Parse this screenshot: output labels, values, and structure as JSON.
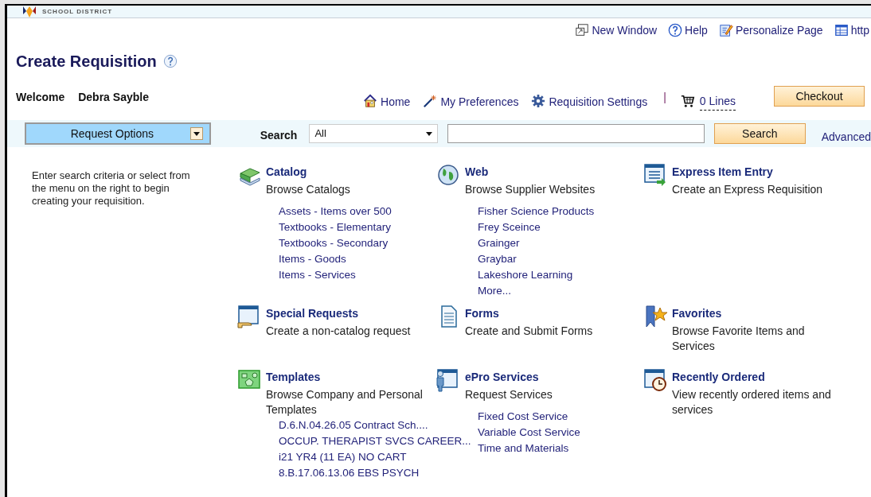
{
  "logo": {
    "text": "SCHOOL DISTRICT"
  },
  "top_links": [
    "New Window",
    "Help",
    "Personalize Page",
    "http"
  ],
  "title": "Create Requisition",
  "welcome": {
    "label": "Welcome",
    "name": "Debra Sayble"
  },
  "nav": {
    "links": [
      "Home",
      "My Preferences",
      "Requisition Settings"
    ],
    "separator": "|",
    "cart": "0 Lines",
    "checkout": "Checkout"
  },
  "search_bar": {
    "options_button": "Request Options",
    "label": "Search",
    "category": "All",
    "button": "Search",
    "advanced": "Advanced"
  },
  "instructions": "Enter search criteria or select from the menu on the right to begin creating your requisition.",
  "tiles": [
    {
      "title": "Catalog",
      "subtitle": "Browse Catalogs",
      "links": [
        "Assets - Items over 500",
        "Textbooks - Elementary",
        "Textbooks - Secondary",
        "Items - Goods",
        "Items - Services"
      ]
    },
    {
      "title": "Web",
      "subtitle": "Browse Supplier Websites",
      "links": [
        "Fisher Science Products",
        "Frey Sceince",
        "Grainger",
        "Graybar",
        "Lakeshore Learning",
        "More..."
      ]
    },
    {
      "title": "Express Item Entry",
      "subtitle": "Create an Express Requisition"
    },
    {
      "title": "Special Requests",
      "subtitle": "Create a non-catalog request"
    },
    {
      "title": "Forms",
      "subtitle": "Create and Submit Forms"
    },
    {
      "title": "Favorites",
      "subtitle": "Browse Favorite Items and Services"
    },
    {
      "title": "Templates",
      "subtitle": "Browse Company and Personal Templates",
      "links": [
        "D.6.N.04.26.05 Contract Sch....",
        "OCCUP. THERAPIST SVCS CAREER...",
        "i21 YR4 (11 EA) NO CART",
        "8.B.17.06.13.06 EBS PSYCH"
      ]
    },
    {
      "title": "ePro Services",
      "subtitle": "Request Services",
      "links": [
        "Fixed Cost Service",
        "Variable Cost Service",
        "Time and Materials"
      ]
    },
    {
      "title": "Recently Ordered",
      "subtitle": "View recently ordered items and services"
    }
  ]
}
